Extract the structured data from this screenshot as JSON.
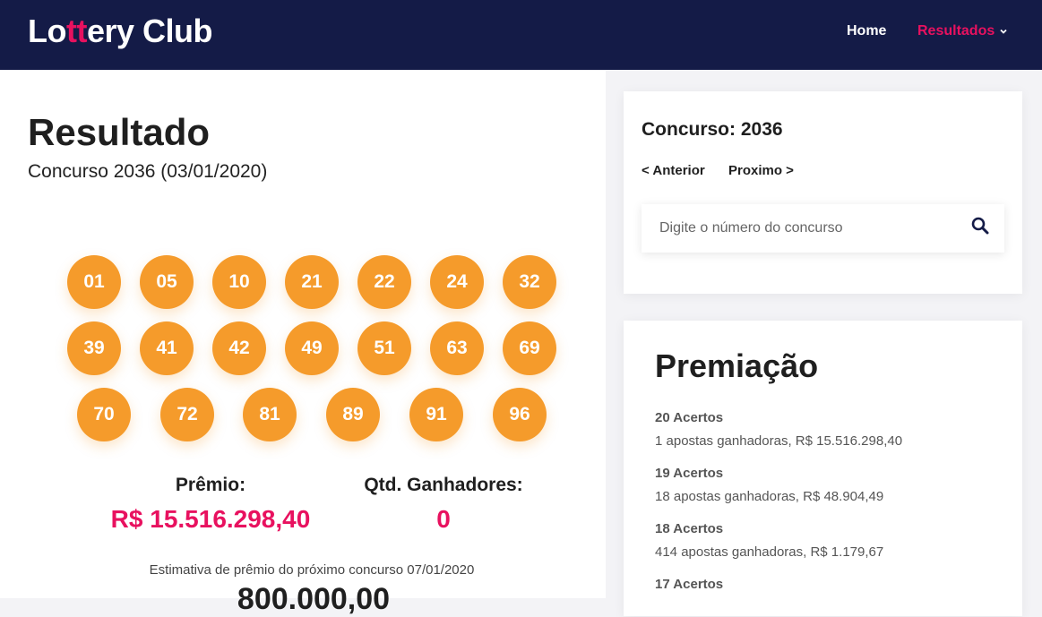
{
  "header": {
    "logo": {
      "part1": "Lo",
      "highlight": "tt",
      "part2": "ery Club"
    },
    "nav": {
      "home": "Home",
      "results": "Resultados"
    }
  },
  "main": {
    "title": "Resultado",
    "subtitle": "Concurso 2036 (03/01/2020)",
    "numbers": [
      "01",
      "05",
      "10",
      "21",
      "22",
      "24",
      "32",
      "39",
      "41",
      "42",
      "49",
      "51",
      "63",
      "69",
      "70",
      "72",
      "81",
      "89",
      "91",
      "96"
    ],
    "premio_label": "Prêmio:",
    "premio_value": "R$ 15.516.298,40",
    "ganhadores_label": "Qtd. Ganhadores:",
    "ganhadores_value": "0",
    "estimate_label": "Estimativa de prêmio do próximo concurso 07/01/2020",
    "estimate_value": "800.000,00"
  },
  "sidebar": {
    "concurso_title": "Concurso: 2036",
    "prev_label": "< Anterior",
    "next_label": "Proximo >",
    "search_placeholder": "Digite o número do concurso",
    "premiacao_title": "Premiação",
    "tiers": [
      {
        "name": "20 Acertos",
        "desc": "1 apostas ganhadoras, R$ 15.516.298,40"
      },
      {
        "name": "19 Acertos",
        "desc": "18 apostas ganhadoras, R$ 48.904,49"
      },
      {
        "name": "18 Acertos",
        "desc": "414 apostas ganhadoras, R$ 1.179,67"
      },
      {
        "name": "17 Acertos",
        "desc": ""
      }
    ]
  },
  "colors": {
    "navbar": "#141b47",
    "accent": "#e8115f",
    "ball": "#f59b2b"
  }
}
